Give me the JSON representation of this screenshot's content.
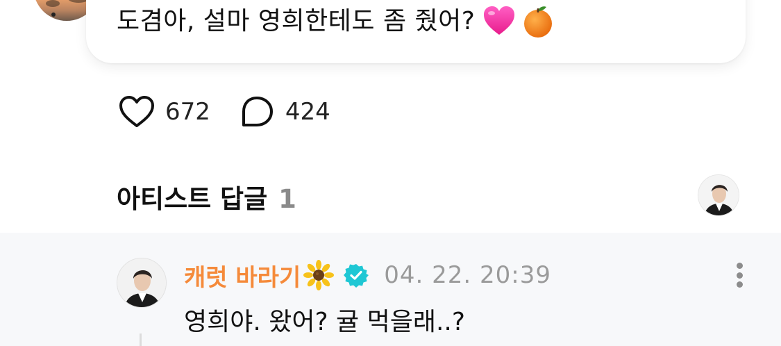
{
  "post": {
    "message": "도겸아, 설마 영희한테도 좀 줬어?",
    "emojis": [
      "heart-emoji",
      "tangerine-emoji"
    ]
  },
  "reactions": {
    "likes": "672",
    "comments": "424"
  },
  "artist_replies": {
    "title": "아티스트 답글",
    "count": "1"
  },
  "comment": {
    "author": "캐럿 바라기",
    "author_emoji": "sunflower-emoji",
    "verified_icon": "verified-badge-icon",
    "timestamp": "04. 22. 20:39",
    "text": "영희야. 왔어? 귤 먹을래..?"
  },
  "colors": {
    "author_name": "#f58a3a",
    "verified_badge": "#1fc7d4",
    "timestamp": "#9a9a9a",
    "comment_bg": "#f7f8fa"
  }
}
